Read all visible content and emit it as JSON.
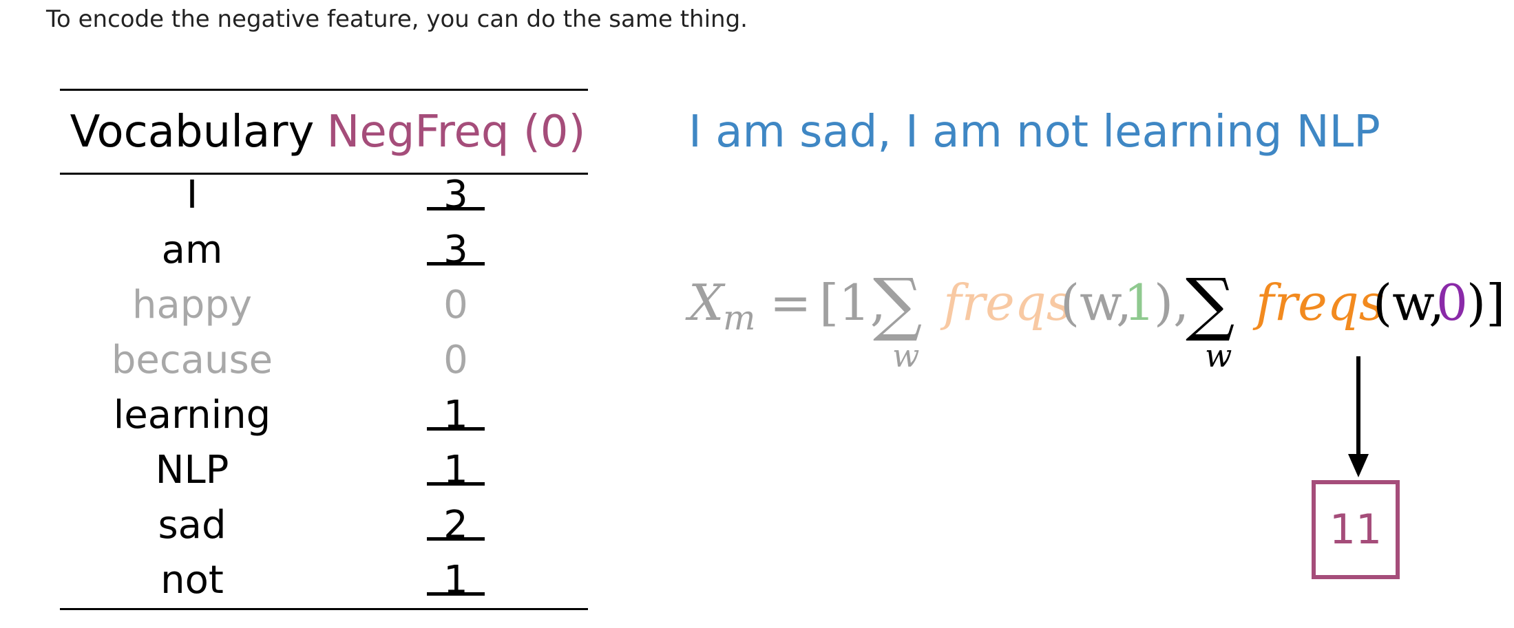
{
  "intro_text": "To encode the negative feature, you can do the same thing.",
  "table": {
    "header_vocab": "Vocabulary",
    "header_freq": "NegFreq (0)",
    "rows": [
      {
        "word": "I",
        "freq": "3",
        "underlined": true,
        "dimmed": false
      },
      {
        "word": "am",
        "freq": "3",
        "underlined": true,
        "dimmed": false
      },
      {
        "word": "happy",
        "freq": "0",
        "underlined": false,
        "dimmed": true
      },
      {
        "word": "because",
        "freq": "0",
        "underlined": false,
        "dimmed": true
      },
      {
        "word": "learning",
        "freq": "1",
        "underlined": true,
        "dimmed": false
      },
      {
        "word": "NLP",
        "freq": "1",
        "underlined": true,
        "dimmed": false
      },
      {
        "word": "sad",
        "freq": "2",
        "underlined": true,
        "dimmed": false
      },
      {
        "word": "not",
        "freq": "1",
        "underlined": true,
        "dimmed": false
      }
    ]
  },
  "sentence": "I am sad, I am not learning NLP",
  "formula": {
    "lhs": "X",
    "lhs_sub": "m",
    "equals": "=",
    "open": "[1,",
    "sigma": "∑",
    "sum_sub": "w",
    "func": "freqs",
    "args1_open": "(w,",
    "args1_class": "1",
    "args1_close": "),",
    "args2_open": "(w,",
    "args2_class": "0",
    "args2_close": ")]"
  },
  "result": "11",
  "colors": {
    "sentence": "#3f87c4",
    "negfreq_header": "#a54d7a",
    "faded_freqs": "#f8c9a3",
    "faded_class_1": "#8fc98f",
    "freqs_orange": "#f28a1f",
    "class_0_purple": "#8a2aa8",
    "result_box": "#a54d7a",
    "dimmed_text": "#a8a8a8"
  }
}
